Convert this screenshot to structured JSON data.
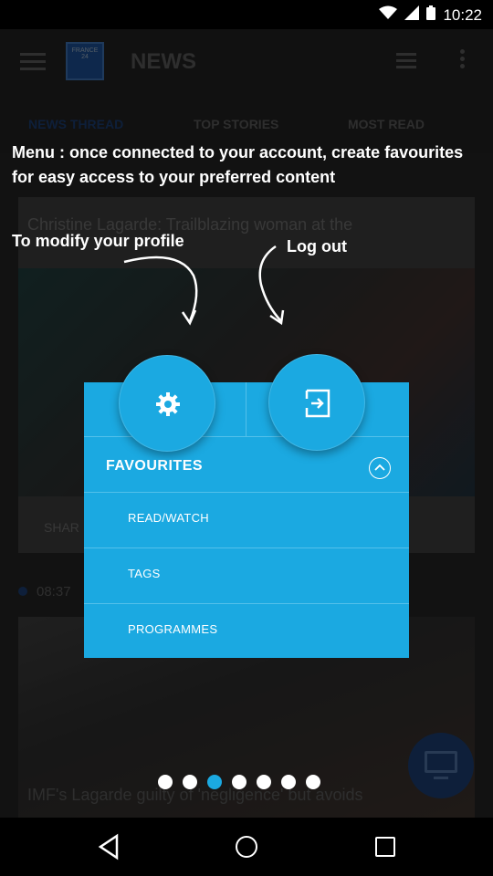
{
  "status_bar": {
    "time": "10:22",
    "icons": [
      "wifi-icon",
      "signal-icon",
      "battery-icon"
    ]
  },
  "app_bar": {
    "title": "NEWS",
    "logo_text": "FRANCE 24"
  },
  "tabs": [
    {
      "label": "NEWS THREAD",
      "active": true
    },
    {
      "label": "TOP STORIES",
      "active": false
    },
    {
      "label": "MOST READ",
      "active": false
    }
  ],
  "feed": {
    "card1_headline": "Christine Lagarde: Trailblazing woman at the",
    "share_label": "SHAR",
    "timestamp": "08:37",
    "card2_headline": "IMF's Lagarde guilty of 'negligence' but avoids"
  },
  "tutorial": {
    "main_hint": "Menu : once connected to your account, create favourites for easy access to your preferred content",
    "profile_hint": "To modify your profile",
    "logout_hint": "Log out",
    "favourites_label": "FAVOURITES",
    "items": [
      "READ/WATCH",
      "TAGS",
      "PROGRAMMES"
    ],
    "page_total": 7,
    "page_current": 3
  },
  "colors": {
    "accent": "#1ba9e1",
    "brand_dark": "#1a3a6a"
  }
}
